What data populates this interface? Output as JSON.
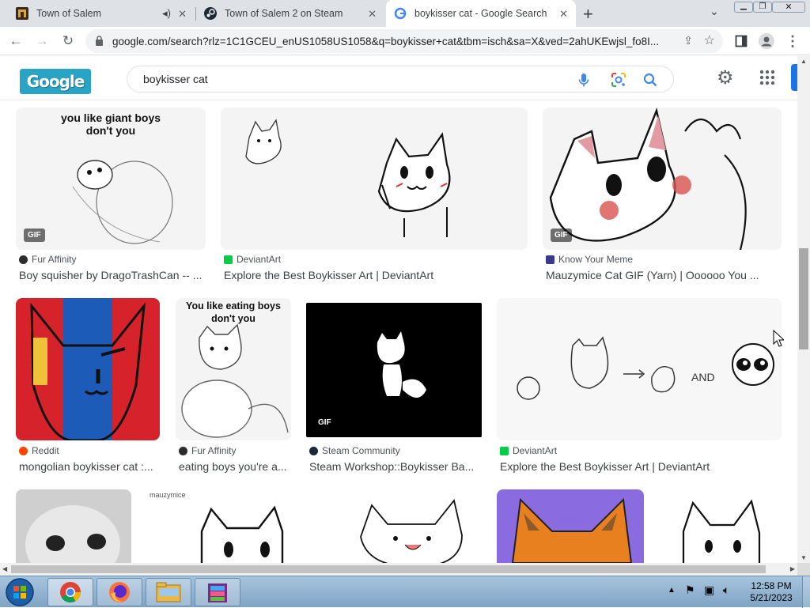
{
  "tabs": [
    {
      "title": "Town of Salem",
      "icon": "town-of-salem-favicon",
      "audio": true
    },
    {
      "title": "Town of Salem 2 on Steam",
      "icon": "steam-favicon"
    },
    {
      "title": "boykisser cat - Google Search",
      "icon": "google-favicon",
      "active": true
    }
  ],
  "toolbar": {
    "url": "google.com/search?rlz=1C1GCEU_enUS1058US1058&q=boykisser+cat&tbm=isch&sa=X&ved=2ahUKEwjsl_fo8I..."
  },
  "google": {
    "logo_text": "Google",
    "query": "boykisser cat"
  },
  "results": [
    {
      "source": "Fur Affinity",
      "title": "Boy squisher by DragoTrashCan -- ...",
      "caption": "you like giant boys don't you",
      "gif": "GIF"
    },
    {
      "source": "DeviantArt",
      "title": "Explore the Best Boykisser Art | DeviantArt"
    },
    {
      "source": "Know Your Meme",
      "title": "Mauzymice Cat GIF (Yarn) | Oooooo You ...",
      "gif": "GIF"
    },
    {
      "source": "Reddit",
      "title": "mongolian boykisser cat :..."
    },
    {
      "source": "Fur Affinity",
      "title": "eating boys you're a...",
      "caption": "You like eating boys don't you"
    },
    {
      "source": "Steam Community",
      "title": "Steam Workshop::Boykisser Ba...",
      "gif": "GIF"
    },
    {
      "source": "DeviantArt",
      "title": "Explore the Best Boykisser Art | DeviantArt",
      "caption": "AND"
    },
    {
      "caption": "mauzymice"
    }
  ],
  "taskbar": {
    "time": "12:58 PM",
    "date": "5/21/2023"
  },
  "colors": {
    "google_blue": "#4285f4",
    "taskbar": "#a7c4dd",
    "fur_affinity": "#2c2c2c",
    "deviantart": "#05cc47",
    "reddit": "#ff4500",
    "steam": "#1b2838",
    "knowyourmeme": "#3a3a8c"
  }
}
